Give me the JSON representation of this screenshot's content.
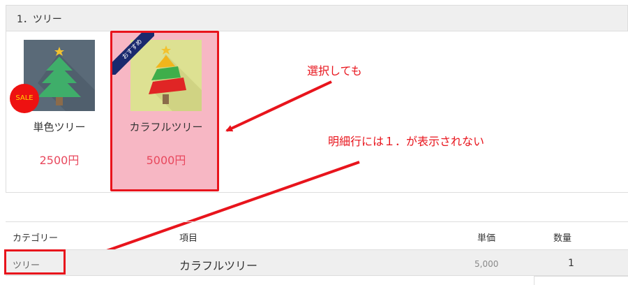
{
  "section": {
    "title": "1．ツリー"
  },
  "products": [
    {
      "name": "単色ツリー",
      "price": "2500円",
      "badge": "SALE",
      "selected": false
    },
    {
      "name": "カラフルツリー",
      "price": "5000円",
      "ribbon": "おすすめ",
      "selected": true
    }
  ],
  "annotations": {
    "note1": "選択しても",
    "note2": "明細行には１．が表示されない"
  },
  "table": {
    "headers": {
      "category": "カテゴリー",
      "item": "項目",
      "unit_price": "単価",
      "quantity": "数量"
    },
    "row": {
      "category": "ツリー",
      "item": "カラフルツリー",
      "unit_price": "5,000",
      "quantity": "1"
    }
  },
  "colors": {
    "accent_red": "#e8141c",
    "price_red": "#e8485d",
    "selected_bg": "#f7b7c4",
    "ribbon_navy": "#1a2a6e"
  },
  "icons": [
    "tree-single-color-icon",
    "tree-colorful-icon",
    "star-icon"
  ]
}
